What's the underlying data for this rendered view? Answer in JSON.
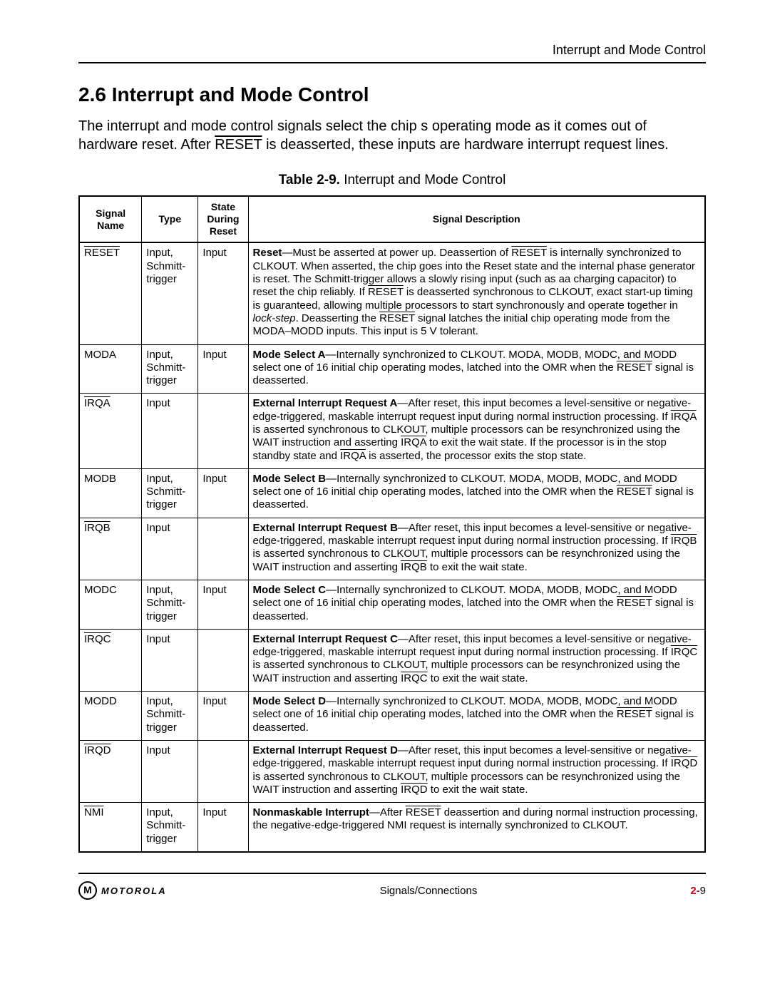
{
  "header_right": "Interrupt and Mode Control",
  "section_number": "2.6",
  "section_title": "Interrupt and Mode Control",
  "intro_html": "The interrupt and mode control signals select the chip s operating mode as it comes out of hardware reset. After <span class=\"over\">RESET</span> is deasserted, these inputs are hardware interrupt request lines.",
  "table_caption_bold": "Table 2-9.",
  "table_caption_rest": " Interrupt and Mode Control",
  "columns": {
    "name": "Signal Name",
    "type": "Type",
    "state": "State During Reset",
    "desc": "Signal Description"
  },
  "rows": [
    {
      "name_html": "<span class=\"over\">RESET</span>",
      "type": "Input, Schmitt-trigger",
      "state": "Input",
      "desc_html": "<b>Reset</b>—Must be asserted at power up. Deassertion of <span class=\"over\">RESET</span> is internally synchronized to CLKOUT. When asserted, the chip goes into the Reset state and the internal phase generator is reset. The Schmitt-trigger allows a slowly rising input (such as aa charging capacitor) to reset the chip reliably. If <span class=\"over\">RESET</span> is deasserted synchronous to CLKOUT, exact start-up timing is guaranteed, allowing multiple processors to start synchronously and operate together in <i>lock-step</i>. Deasserting the <span class=\"over\">RESET</span> signal latches the initial chip operating mode from the MODA–MODD inputs. This input is 5 V tolerant."
    },
    {
      "name_html": "MODA",
      "type": "Input, Schmitt-trigger",
      "state": "Input",
      "desc_html": "<b>Mode Select A</b>—Internally synchronized to CLKOUT. MODA, MODB, MODC, and MODD select one of 16 initial chip operating modes, latched into the OMR when the <span class=\"over\">RESET</span> signal is deasserted."
    },
    {
      "name_html": "<span class=\"over\">IRQA</span>",
      "type": "Input",
      "state": "",
      "desc_html": "<b>External Interrupt Request A</b>—After reset, this input becomes a level-sensitive or negative-edge-triggered, maskable interrupt request input during normal instruction processing. If <span class=\"over\">IRQA</span> is asserted synchronous to CLKOUT, multiple processors can be resynchronized using the WAIT instruction and asserting <span class=\"over\">IRQA</span> to exit the wait state. If the processor is in the stop standby state and <span class=\"over\">IRQA</span> is asserted, the processor exits the stop state."
    },
    {
      "name_html": "MODB",
      "type": "Input, Schmitt-trigger",
      "state": "Input",
      "desc_html": "<b>Mode Select B</b>—Internally synchronized to CLKOUT. MODA, MODB, MODC, and MODD select one of 16 initial chip operating modes, latched into the OMR when the <span class=\"over\">RESET</span> signal is deasserted."
    },
    {
      "name_html": "<span class=\"over\">IRQB</span>",
      "type": "Input",
      "state": "",
      "desc_html": "<b>External Interrupt Request B</b>—After reset, this input becomes a level-sensitive or negative-edge-triggered, maskable interrupt request input during normal instruction processing. If <span class=\"over\">IRQB</span> is asserted synchronous to CLKOUT, multiple processors can be resynchronized using the WAIT instruction and asserting <span class=\"over\">IRQB</span> to exit the wait state."
    },
    {
      "name_html": "MODC",
      "type": "Input, Schmitt-trigger",
      "state": "Input",
      "desc_html": "<b>Mode Select C</b>—Internally synchronized to CLKOUT. MODA, MODB, MODC, and MODD select one of 16 initial chip operating modes, latched into the OMR when the <span class=\"over\">RESET</span> signal is deasserted."
    },
    {
      "name_html": "<span class=\"over\">IRQC</span>",
      "type": "Input",
      "state": "",
      "desc_html": "<b>External Interrupt Request C</b>—After reset, this input becomes a level-sensitive or negative-edge-triggered, maskable interrupt request input during normal instruction processing. If <span class=\"over\">IRQC</span> is asserted synchronous to CLKOUT, multiple processors can be resynchronized using the WAIT instruction and asserting <span class=\"over\">IRQC</span> to exit the wait state."
    },
    {
      "name_html": "MODD",
      "type": "Input, Schmitt-trigger",
      "state": "Input",
      "desc_html": "<b>Mode Select D</b>—Internally synchronized to CLKOUT. MODA, MODB, MODC, and MODD select one of 16 initial chip operating modes, latched into the OMR when the <span class=\"over\">RESET</span> signal is deasserted."
    },
    {
      "name_html": "<span class=\"over\">IRQD</span>",
      "type": "Input",
      "state": "",
      "desc_html": "<b>External Interrupt Request D</b>—After reset, this input becomes a level-sensitive or negative-edge-triggered, maskable interrupt request input during normal instruction processing. If <span class=\"over\">IRQD</span> is asserted synchronous to CLKOUT, multiple processors can be resynchronized using the WAIT instruction and asserting <span class=\"over\">IRQD</span> to exit the wait state."
    },
    {
      "name_html": "<span class=\"over\">NMI</span>",
      "type": "Input, Schmitt-trigger",
      "state": "Input",
      "desc_html": "<b>Nonmaskable Interrupt</b>—After <span class=\"over\">RESET</span> deassertion and during normal instruction processing, the negative-edge-triggered NMI request is internally synchronized to CLKOUT."
    }
  ],
  "footer": {
    "brand": "MOTOROLA",
    "center": "Signals/Connections",
    "page_prefix": "2-",
    "page_num": "9"
  }
}
